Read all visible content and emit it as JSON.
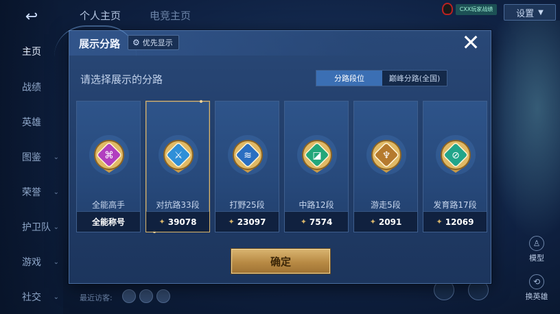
{
  "background": {
    "top_tabs": [
      "个人主页",
      "电竞主页"
    ],
    "settings_label": "设置",
    "user_chip_text": "CXX玩家战绩",
    "sidebar_items": [
      {
        "label": "主页",
        "active": true,
        "chevron": false
      },
      {
        "label": "战绩",
        "active": false,
        "chevron": false
      },
      {
        "label": "英雄",
        "active": false,
        "chevron": false
      },
      {
        "label": "图鉴",
        "active": false,
        "chevron": true
      },
      {
        "label": "荣誉",
        "active": false,
        "chevron": true
      },
      {
        "label": "护卫队",
        "active": false,
        "chevron": true
      },
      {
        "label": "游戏",
        "active": false,
        "chevron": true
      },
      {
        "label": "社交",
        "active": false,
        "chevron": true
      }
    ],
    "recent_visitors_label": "最近访客:",
    "model_label": "模型",
    "swap_hero_label": "换英雄"
  },
  "dialog": {
    "title": "展示分路",
    "priority_button": "优先显示",
    "prompt": "请选择展示的分路",
    "toggle": {
      "active": "分路段位",
      "inactive": "巅峰分路(全国)"
    },
    "confirm_label": "确定",
    "cards": [
      {
        "label": "全能高手",
        "footer": "全能称号",
        "has_score_icon": false,
        "selected": false,
        "emblem": "allround-emblem-icon",
        "color": "#b13fbf"
      },
      {
        "label": "对抗路33段",
        "footer": "39078",
        "has_score_icon": true,
        "selected": true,
        "emblem": "clash-lane-emblem-icon",
        "color": "#2f8fd8"
      },
      {
        "label": "打野25段",
        "footer": "23097",
        "has_score_icon": true,
        "selected": false,
        "emblem": "jungle-emblem-icon",
        "color": "#2a6fc2"
      },
      {
        "label": "中路12段",
        "footer": "7574",
        "has_score_icon": true,
        "selected": false,
        "emblem": "mid-lane-emblem-icon",
        "color": "#23a77a"
      },
      {
        "label": "游走5段",
        "footer": "2091",
        "has_score_icon": true,
        "selected": false,
        "emblem": "roam-emblem-icon",
        "color": "#b57a2e"
      },
      {
        "label": "发育路17段",
        "footer": "12069",
        "has_score_icon": true,
        "selected": false,
        "emblem": "farm-lane-emblem-icon",
        "color": "#22a58a"
      }
    ]
  },
  "colors": {
    "dialog_bg": "#223e6a",
    "accent_blue": "#3b6fb4",
    "gold": "#d9b46a"
  }
}
